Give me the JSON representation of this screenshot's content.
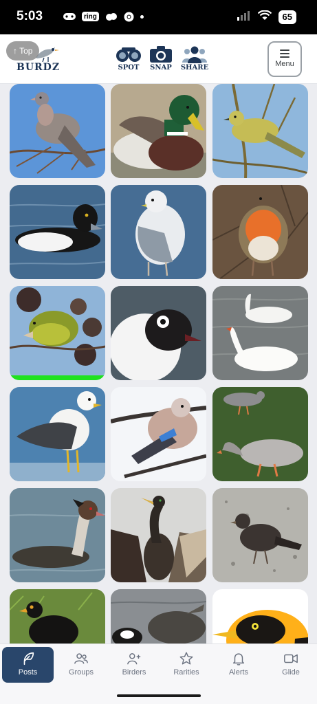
{
  "status_bar": {
    "time": "5:03",
    "ring_label": "ring",
    "battery": "65"
  },
  "header": {
    "brand": "BURDZ",
    "top_button": "↑ Top",
    "actions": [
      {
        "label": "SPOT",
        "icon": "binoculars-icon"
      },
      {
        "label": "SNAP",
        "icon": "camera-icon"
      },
      {
        "label": "SHARE",
        "icon": "people-icon"
      }
    ],
    "menu_label": "Menu"
  },
  "photos": [
    {
      "subject": "wood-pigeon"
    },
    {
      "subject": "mallard"
    },
    {
      "subject": "warbler"
    },
    {
      "subject": "tufted-duck"
    },
    {
      "subject": "common-gull"
    },
    {
      "subject": "robin"
    },
    {
      "subject": "greenfinch",
      "highlight": true
    },
    {
      "subject": "black-headed-gull"
    },
    {
      "subject": "mute-swans"
    },
    {
      "subject": "lesser-black-backed-gull"
    },
    {
      "subject": "jay"
    },
    {
      "subject": "greylag-geese"
    },
    {
      "subject": "great-crested-grebe"
    },
    {
      "subject": "cormorant"
    },
    {
      "subject": "blackbird-female"
    },
    {
      "subject": "blackbird-male"
    },
    {
      "subject": "canada-goose"
    },
    {
      "subject": "bowerbird"
    }
  ],
  "bottom_nav": [
    {
      "label": "Posts",
      "icon": "feather-icon",
      "active": true
    },
    {
      "label": "Groups",
      "icon": "groups-icon"
    },
    {
      "label": "Birders",
      "icon": "add-person-icon"
    },
    {
      "label": "Rarities",
      "icon": "star-icon"
    },
    {
      "label": "Alerts",
      "icon": "bell-icon"
    },
    {
      "label": "Glide",
      "icon": "video-icon"
    }
  ],
  "colors": {
    "brand_navy": "#1d3557",
    "active_tab": "#29466b",
    "highlight_green": "#1fe21f",
    "grid_background": "#ecedf1"
  }
}
